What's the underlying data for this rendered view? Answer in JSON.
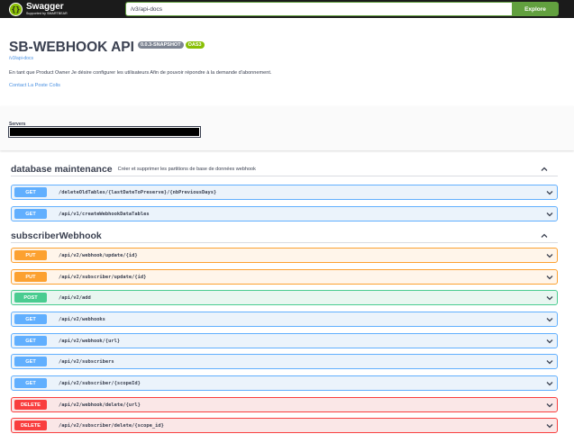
{
  "topbar": {
    "logo_title": "Swagger",
    "logo_subtitle": "Supported by SMARTBEAR",
    "url_value": "/v3/api-docs",
    "explore_label": "Explore"
  },
  "info": {
    "title": "SB-WEBHOOK API",
    "version": "0.0.3-SNAPSHOT",
    "oas": "OAS3",
    "spec_link": "/v3/api-docs",
    "description": "En tant que Product Owner Je désire configurer les utilisateurs Afin de pouvoir répondre à la demande d'abonnement.",
    "contact": "Contact La Poste Colis"
  },
  "servers": {
    "label": "Servers",
    "selected": ""
  },
  "tags": [
    {
      "name": "database maintenance",
      "description": "Créer et supprimer les partitions de base de données webhook",
      "operations": [
        {
          "method": "GET",
          "path": "/deleteOldTables/{lastDateToPreserve}/{nbPreviousDays}"
        },
        {
          "method": "GET",
          "path": "/api/v1/createWebhookDataTables"
        }
      ]
    },
    {
      "name": "subscriberWebhook",
      "description": "",
      "operations": [
        {
          "method": "PUT",
          "path": "/api/v2/webhook/update/{id}"
        },
        {
          "method": "PUT",
          "path": "/api/v2/subscriber/update/{id}"
        },
        {
          "method": "POST",
          "path": "/api/v2/add"
        },
        {
          "method": "GET",
          "path": "/api/v2/webhooks"
        },
        {
          "method": "GET",
          "path": "/api/v2/webhook/{url}"
        },
        {
          "method": "GET",
          "path": "/api/v2/subscribers"
        },
        {
          "method": "GET",
          "path": "/api/v2/subscriber/{scopeId}"
        },
        {
          "method": "DELETE",
          "path": "/api/v2/webhook/delete/{url}"
        },
        {
          "method": "DELETE",
          "path": "/api/v2/subscriber/delete/{scope_id}"
        }
      ]
    }
  ],
  "colors": {
    "get": "#61affe",
    "put": "#fca130",
    "post": "#49cc90",
    "delete": "#f93e3e",
    "topbar": "#1b1b1b",
    "explore": "#62a03f"
  }
}
